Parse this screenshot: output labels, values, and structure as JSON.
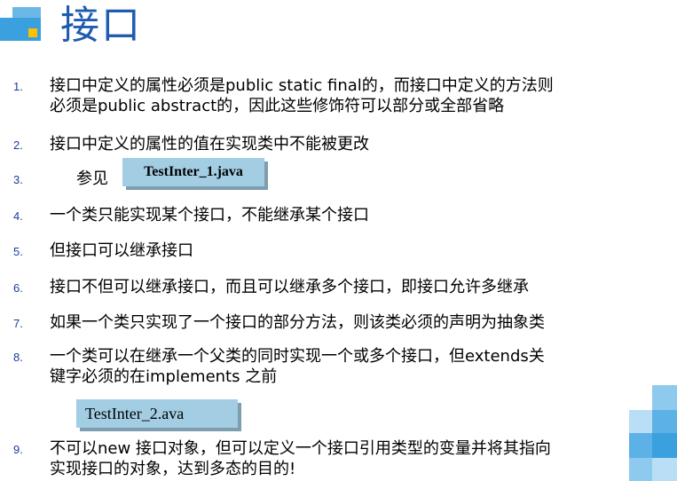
{
  "slide": {
    "title": "接口",
    "items": [
      {
        "num": "1.",
        "lines": [
          "接口中定义的属性必须是public static final的，而接口中定义的方法则",
          "必须是public abstract的，因此这些修饰符可以部分或全部省略"
        ]
      },
      {
        "num": "2.",
        "lines": [
          "接口中定义的属性的值在实现类中不能被更改"
        ]
      },
      {
        "num": "3.",
        "prefix": "参见",
        "code": "TestInter_1.java"
      },
      {
        "num": "4.",
        "lines": [
          "一个类只能实现某个接口，不能继承某个接口"
        ]
      },
      {
        "num": "5.",
        "lines": [
          "但接口可以继承接口"
        ]
      },
      {
        "num": "6.",
        "lines": [
          "接口不但可以继承接口，而且可以继承多个接口，即接口允许多继承"
        ]
      },
      {
        "num": "7.",
        "lines": [
          "如果一个类只实现了一个接口的部分方法，则该类必须的声明为抽象类"
        ]
      },
      {
        "num": "8.",
        "lines": [
          "一个类可以在继承一个父类的同时实现一个或多个接口，但extends关",
          "键字必须的在implements 之前"
        ]
      },
      {
        "code": "TestInter_2.ava"
      },
      {
        "num": "9.",
        "lines": [
          "不可以new 接口对象，但可以定义一个接口引用类型的变量并将其指向",
          "实现接口的对象，达到多态的目的!"
        ]
      }
    ]
  },
  "colors": {
    "title": "#1f5bb0",
    "bullet_numbers": "#1a3d9c",
    "code_box": "#a2cde3",
    "deco_blue": "#3aa0de",
    "deco_yellow": "#ffc000"
  }
}
